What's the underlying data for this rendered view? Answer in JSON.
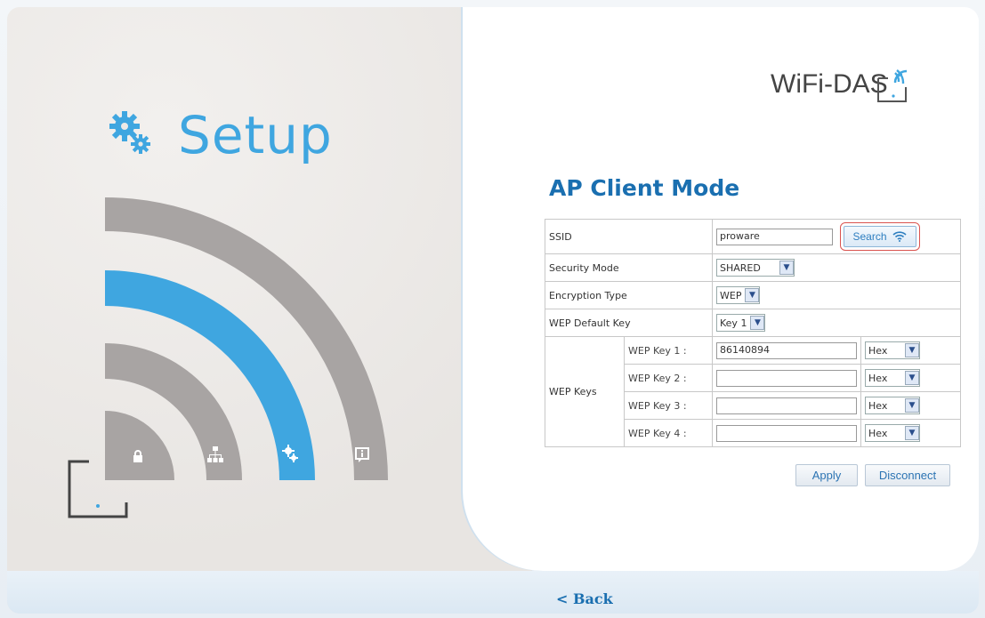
{
  "brand": {
    "logo_text": "WiFi-DAS"
  },
  "left": {
    "title": "Setup"
  },
  "form": {
    "title": "AP Client Mode",
    "ssid": {
      "label": "SSID",
      "value": "proware",
      "search_label": "Search"
    },
    "security_mode": {
      "label": "Security Mode",
      "value": "SHARED"
    },
    "encryption_type": {
      "label": "Encryption Type",
      "value": "WEP"
    },
    "wep_default_key": {
      "label": "WEP Default Key",
      "value": "Key 1"
    },
    "wep_keys": {
      "label": "WEP Keys",
      "items": [
        {
          "label": "WEP Key 1 :",
          "value": "86140894",
          "format": "Hex"
        },
        {
          "label": "WEP Key 2 :",
          "value": "",
          "format": "Hex"
        },
        {
          "label": "WEP Key 3 :",
          "value": "",
          "format": "Hex"
        },
        {
          "label": "WEP Key 4 :",
          "value": "",
          "format": "Hex"
        }
      ]
    },
    "apply_label": "Apply",
    "disconnect_label": "Disconnect"
  },
  "nav": {
    "back_label": "< Back"
  },
  "icons": [
    "gear-icon",
    "lock-icon",
    "network-icon",
    "settings-icon",
    "info-icon",
    "router-icon",
    "wifi-icon"
  ],
  "colors": {
    "accent_blue": "#3fa6e0",
    "title_blue": "#1a6fb0",
    "arc_gray": "#a8a4a3",
    "highlight_red": "#d9534f"
  }
}
